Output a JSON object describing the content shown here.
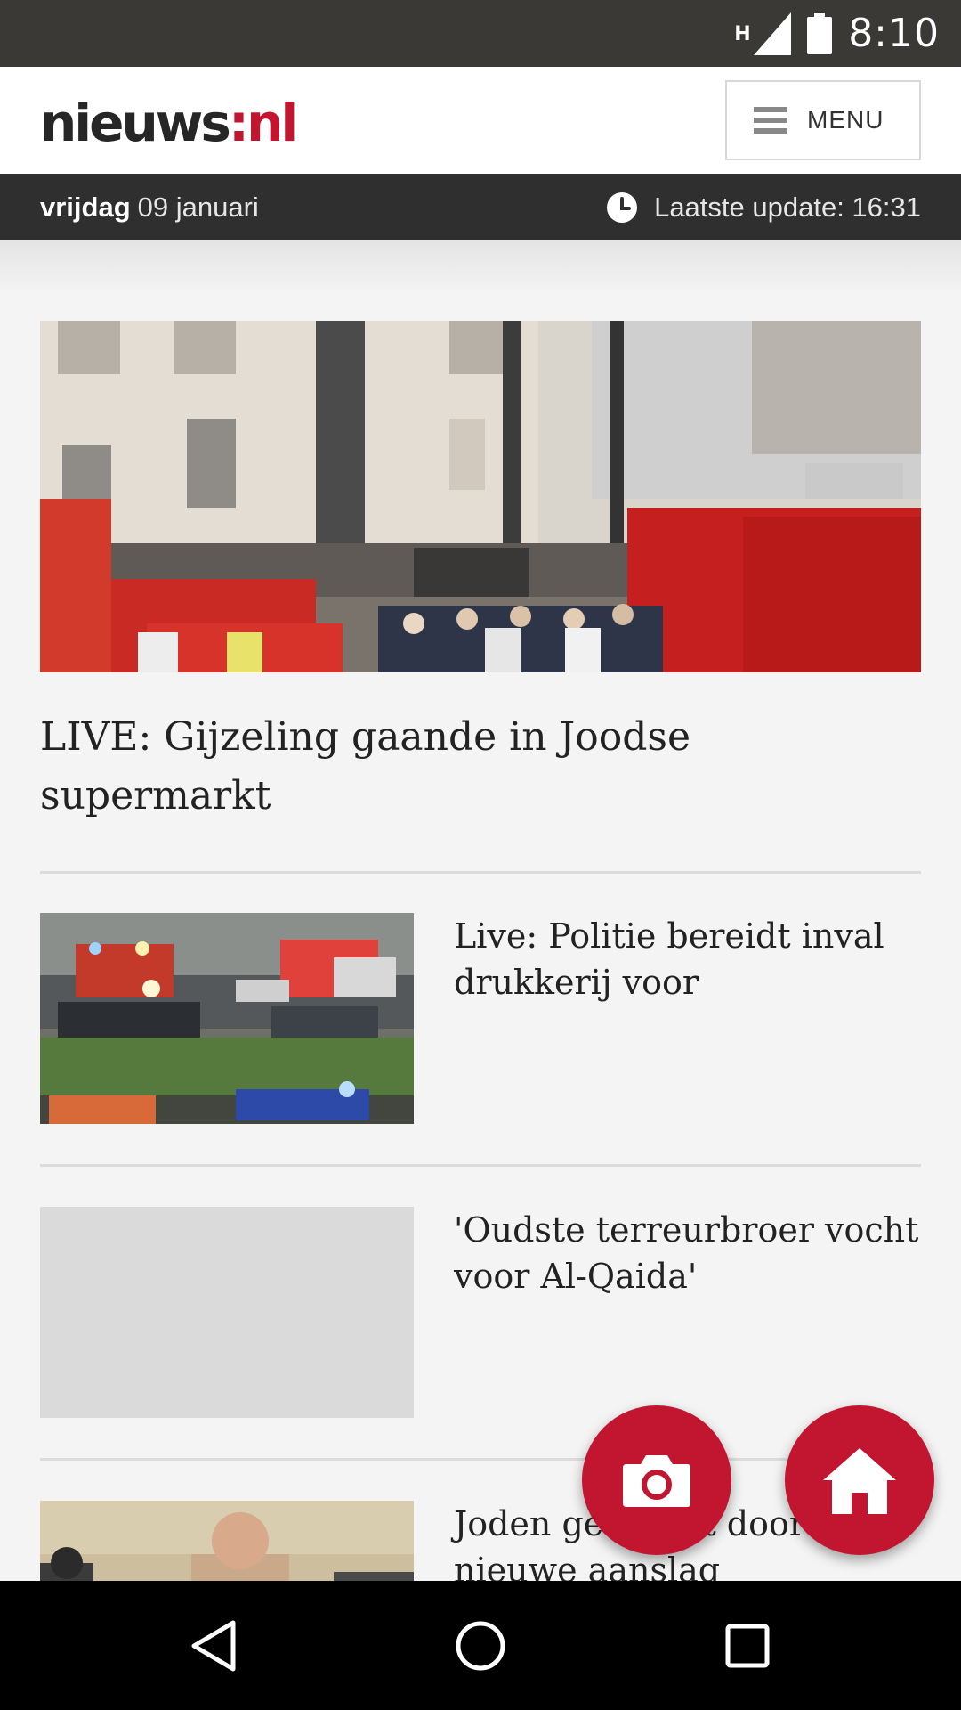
{
  "status_bar": {
    "network_type": "H",
    "time": "8:10",
    "icons": [
      "signal-icon",
      "battery-icon"
    ]
  },
  "header": {
    "logo_part1": "nieuws",
    "logo_part2": ":nl",
    "menu_label": "MENU",
    "menu_icon": "hamburger-icon"
  },
  "datebar": {
    "day_name": "vrijdag",
    "date": "09 januari",
    "update_label": "Laatste update: 16:31",
    "clock_icon": "clock-icon"
  },
  "articles": {
    "hero": {
      "title": "LIVE: Gijzeling gaande in Joodse supermarkt"
    },
    "items": [
      {
        "title": "Live: Politie bereidt inval drukkerij voor"
      },
      {
        "title": "'Oudste terreurbroer vocht voor Al-Qaida'"
      },
      {
        "title": "Joden geschokt door nieuwe aanslag"
      }
    ]
  },
  "fabs": {
    "camera_icon": "camera-icon",
    "home_icon": "home-icon"
  },
  "navbar": {
    "icons": [
      "back-icon",
      "home-circle-icon",
      "recents-icon"
    ]
  },
  "colors": {
    "brand_red": "#c2152f",
    "status_bar": "#3b3935",
    "date_bar": "#2f2f2f"
  }
}
